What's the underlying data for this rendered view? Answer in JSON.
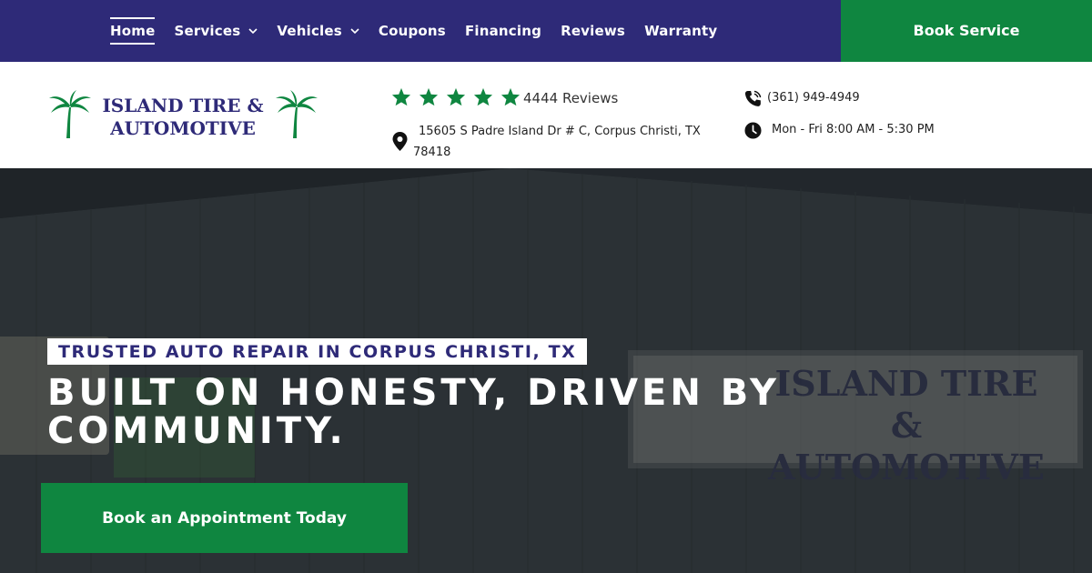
{
  "nav": {
    "items": [
      {
        "label": "Home",
        "active": true,
        "has_dropdown": false
      },
      {
        "label": "Services",
        "active": false,
        "has_dropdown": true
      },
      {
        "label": "Vehicles",
        "active": false,
        "has_dropdown": true
      },
      {
        "label": "Coupons",
        "active": false,
        "has_dropdown": false
      },
      {
        "label": "Financing",
        "active": false,
        "has_dropdown": false
      },
      {
        "label": "Reviews",
        "active": false,
        "has_dropdown": false
      },
      {
        "label": "Warranty",
        "active": false,
        "has_dropdown": false
      }
    ],
    "book_service_label": "Book Service"
  },
  "header": {
    "logo_line1": "ISLAND TIRE &",
    "logo_line2": "AUTOMOTIVE",
    "rating_stars": 5,
    "reviews_text": "4444 Reviews",
    "address": "15605 S Padre Island Dr # C, Corpus Christi, TX 78418",
    "phone": "(361) 949-4949",
    "hours": "Mon - Fri 8:00 AM - 5:30 PM",
    "icons": [
      "star-icon",
      "map-pin-icon",
      "phone-icon",
      "clock-icon",
      "palm-tree-icon",
      "chevron-down-icon"
    ]
  },
  "hero": {
    "eyebrow": "TRUSTED AUTO REPAIR IN CORPUS CHRISTI, TX",
    "headline": "BUILT ON HONESTY, DRIVEN BY COMMUNITY.",
    "cta_label": "Book an Appointment Today",
    "background_sign_line1": "ISLAND TIRE",
    "background_sign_line2": "& AUTOMOTIVE"
  },
  "colors": {
    "brand_navy": "#2e2a78",
    "brand_green": "#0f8640",
    "star_green": "#0f8640",
    "white": "#ffffff"
  }
}
